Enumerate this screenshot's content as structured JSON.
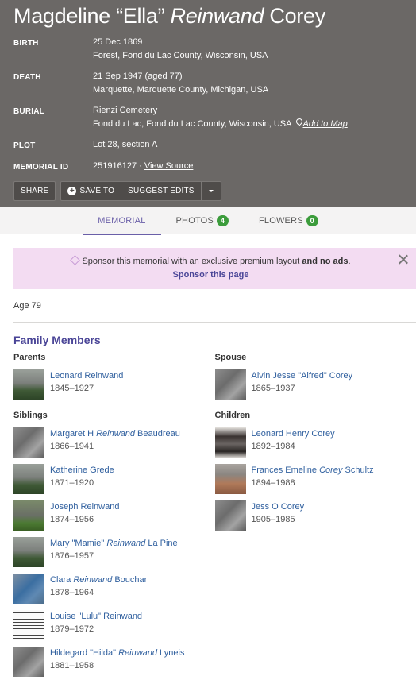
{
  "memorial": {
    "title_first": "Magdeline “Ella”",
    "title_maiden": "Reinwand",
    "title_last": "Corey"
  },
  "facts": {
    "birth_label": "BIRTH",
    "birth_date": "25 Dec 1869",
    "birth_place": "Forest, Fond du Lac County, Wisconsin, USA",
    "death_label": "DEATH",
    "death_date": "21 Sep 1947 (aged 77)",
    "death_place": "Marquette, Marquette County, Michigan, USA",
    "burial_label": "BURIAL",
    "burial_cemetery": "Rienzi Cemetery",
    "burial_place": "Fond du Lac, Fond du Lac County, Wisconsin, USA",
    "add_to_map": "Add to Map",
    "plot_label": "PLOT",
    "plot_value": "Lot 28, section A",
    "memorial_id_label": "MEMORIAL ID",
    "memorial_id_value": "251916127 ·",
    "view_source": "View Source"
  },
  "actions": {
    "share": "SHARE",
    "save_to": "SAVE TO",
    "suggest_edits": "SUGGEST EDITS"
  },
  "tabs": {
    "memorial": "MEMORIAL",
    "photos": "PHOTOS",
    "photos_count": "4",
    "flowers": "FLOWERS",
    "flowers_count": "0"
  },
  "sponsor": {
    "text": "Sponsor this memorial with an exclusive premium layout",
    "text_and": "and no ads",
    "text_end": ".",
    "link": "Sponsor this page"
  },
  "age": "Age 79",
  "family": {
    "title": "Family Members",
    "parents_label": "Parents",
    "spouse_label": "Spouse",
    "siblings_label": "Siblings",
    "children_label": "Children",
    "parents": [
      {
        "name_a": "Leonard Reinwand",
        "name_i": "",
        "name_b": "",
        "dates": "1845–1927"
      }
    ],
    "spouse": [
      {
        "name_a": "Alvin Jesse \"Alfred\" Corey",
        "name_i": "",
        "name_b": "",
        "dates": "1865–1937"
      }
    ],
    "siblings": [
      {
        "name_a": "Margaret H ",
        "name_i": "Reinwand",
        "name_b": " Beaudreau",
        "dates": "1866–1941"
      },
      {
        "name_a": "Katherine Grede",
        "name_i": "",
        "name_b": "",
        "dates": "1871–1920"
      },
      {
        "name_a": "Joseph Reinwand",
        "name_i": "",
        "name_b": "",
        "dates": "1874–1956"
      },
      {
        "name_a": "Mary \"Mamie\" ",
        "name_i": "Reinwand",
        "name_b": " La Pine",
        "dates": "1876–1957"
      },
      {
        "name_a": "Clara ",
        "name_i": "Reinwand",
        "name_b": " Bouchar",
        "dates": "1878–1964"
      },
      {
        "name_a": "Louise \"Lulu\" Reinwand",
        "name_i": "",
        "name_b": "",
        "dates": "1879–1972"
      },
      {
        "name_a": "Hildegard \"Hilda\" ",
        "name_i": "Reinwand",
        "name_b": " Lyneis",
        "dates": "1881–1958"
      }
    ],
    "children": [
      {
        "name_a": "Leonard Henry Corey",
        "name_i": "",
        "name_b": "",
        "dates": "1892–1984"
      },
      {
        "name_a": "Frances Emeline ",
        "name_i": "Corey",
        "name_b": " Schultz",
        "dates": "1894–1988"
      },
      {
        "name_a": "Jess O Corey",
        "name_i": "",
        "name_b": "",
        "dates": "1905–1985"
      }
    ]
  },
  "colors": {
    "header_bg": "#6b6866",
    "link": "#2f5f9e",
    "accent_purple": "#4a4597",
    "badge_green": "#3c9c3c",
    "sponsor_bg": "#f3dcf2"
  },
  "thumbnails": {
    "parents": [
      "photo-grave"
    ],
    "spouse": [
      "photo-stone"
    ],
    "siblings": [
      "photo-stone",
      "photo-grave",
      "photo-grass",
      "photo-grave",
      "photo-blue",
      "photo-clipping",
      "photo-stone"
    ],
    "children": [
      "photo-dark",
      "photo-brick",
      "photo-stone"
    ]
  }
}
